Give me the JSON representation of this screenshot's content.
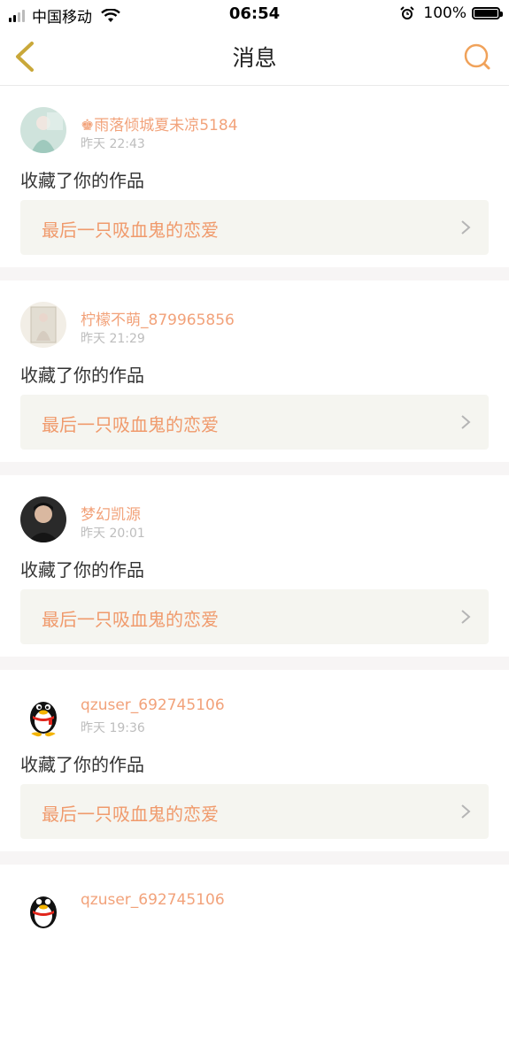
{
  "status_bar": {
    "carrier": "中国移动",
    "time": "06:54",
    "battery": "100%"
  },
  "nav": {
    "title": "消息",
    "back_icon": "chevron-left-icon",
    "search_icon": "search-icon",
    "accent_color": "#f0a25a"
  },
  "notifications": [
    {
      "username": "♚雨落倾城夏未凉5184",
      "time": "昨天 22:43",
      "action": "收藏了你的作品",
      "work_title": "最后一只吸血鬼的恋爱"
    },
    {
      "username": "柠檬不萌_879965856",
      "time": "昨天 21:29",
      "action": "收藏了你的作品",
      "work_title": "最后一只吸血鬼的恋爱"
    },
    {
      "username": "梦幻凯源",
      "time": "昨天 20:01",
      "action": "收藏了你的作品",
      "work_title": "最后一只吸血鬼的恋爱"
    },
    {
      "username": "qzuser_692745106",
      "time": "昨天 19:36",
      "action": "收藏了你的作品",
      "work_title": "最后一只吸血鬼的恋爱"
    },
    {
      "username": "qzuser_692745106",
      "time": "",
      "action": "",
      "work_title": ""
    }
  ]
}
